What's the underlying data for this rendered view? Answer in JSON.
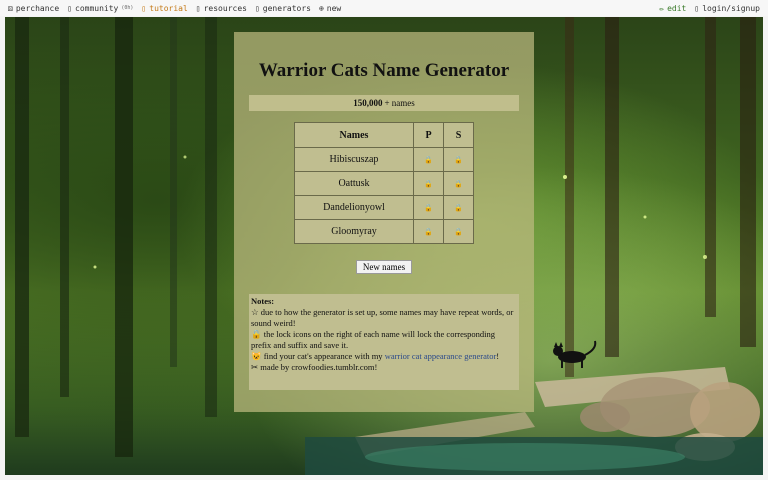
{
  "topbar": {
    "logo_label": "perchance",
    "community_label": "community",
    "community_badge": "(0h)",
    "tutorial_label": "tutorial",
    "resources_label": "resources",
    "generators_label": "generators",
    "new_label": "new",
    "edit_label": "edit",
    "login_label": "login/signup"
  },
  "generator": {
    "title": "Warrior Cats Name Generator",
    "count_value": "150,000",
    "count_suffix": "+ names",
    "table_headers": {
      "names": "Names",
      "p": "P",
      "s": "S"
    },
    "names": [
      "Hibiscuszap",
      "Oattusk",
      "Dandelionyowl",
      "Gloomyray"
    ],
    "lock_glyph": "🔒",
    "new_button_label": "New names"
  },
  "notes": {
    "heading": "Notes:",
    "line1": "☆ due to how the generator is set up, some names may have repeat words, or sound weird!",
    "line2_icon": "🔒",
    "line2": "the lock icons on the right of each name will lock the corresponding prefix and suffix and save it.",
    "line3_icon": "😺",
    "line3_pre": "find your cat's appearance with my ",
    "line3_link": "warrior cat appearance generator",
    "line3_post": "!",
    "line4_icon": "✂",
    "line4": "made by crowfoodies.tumblr.com!"
  }
}
